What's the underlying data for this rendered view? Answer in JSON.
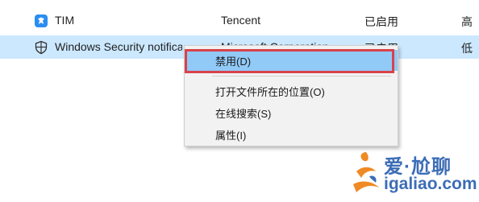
{
  "rows": [
    {
      "name": "TIM",
      "publisher": "Tencent",
      "status": "已启用",
      "impact": "高",
      "icon": "tim-icon"
    },
    {
      "name": "Windows Security notification icon",
      "publisher": "Microsoft Corporation",
      "status": "已启用",
      "impact": "低",
      "icon": "shield-icon"
    }
  ],
  "context_menu": {
    "items": [
      "禁用(D)",
      "打开文件所在的位置(O)",
      "在线搜索(S)",
      "属性(I)"
    ]
  },
  "watermark": {
    "line1": "爱·尬聊",
    "line2": "igaliao.com"
  },
  "colors": {
    "selected_row": "#cce8ff",
    "menu_hover": "#91c9f7",
    "highlight_box": "#d8424a",
    "watermark": "#3c6db6"
  }
}
